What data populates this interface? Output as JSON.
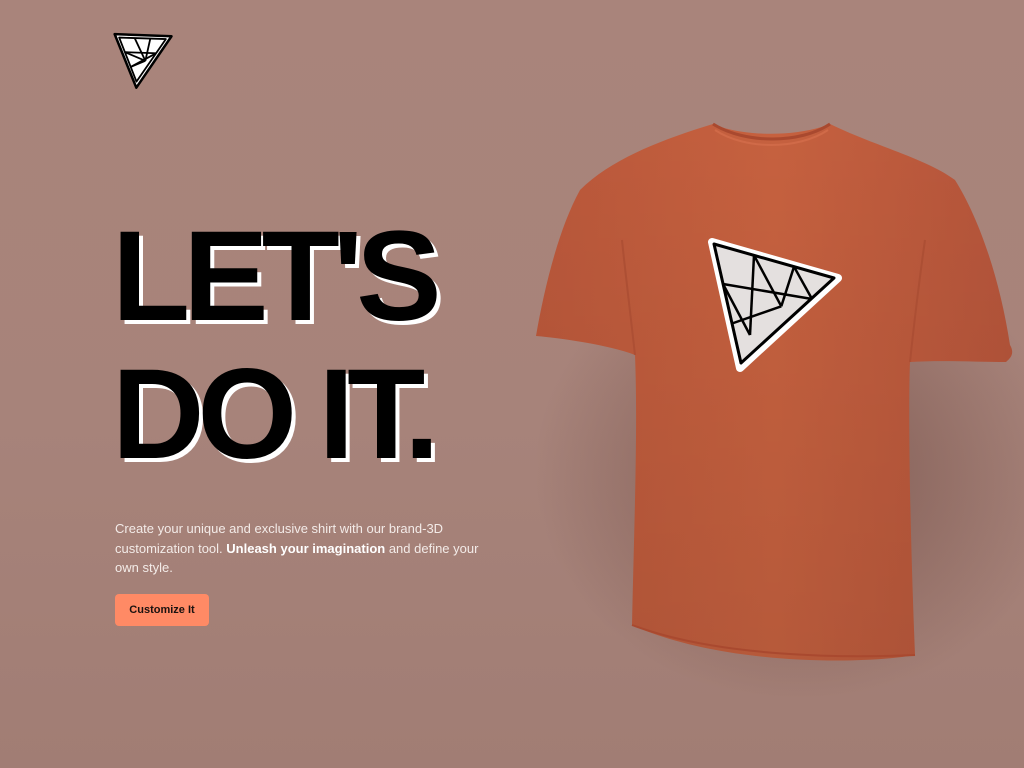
{
  "header": {
    "logo_icon": "triangle-logo-icon"
  },
  "hero": {
    "headline_line1": "LET'S",
    "headline_line2": "DO IT.",
    "description_part1": "Create your unique and exclusive shirt with our brand-3D customization tool. ",
    "description_bold": "Unleash your imagination",
    "description_part2": " and define your own style.",
    "cta_label": "Customize It"
  },
  "preview": {
    "shirt_color": "#c35e3f",
    "decal_icon": "triangle-logo-icon"
  },
  "colors": {
    "background": "#a9847b",
    "accent": "#ff8a65",
    "shirt": "#c35e3f"
  }
}
